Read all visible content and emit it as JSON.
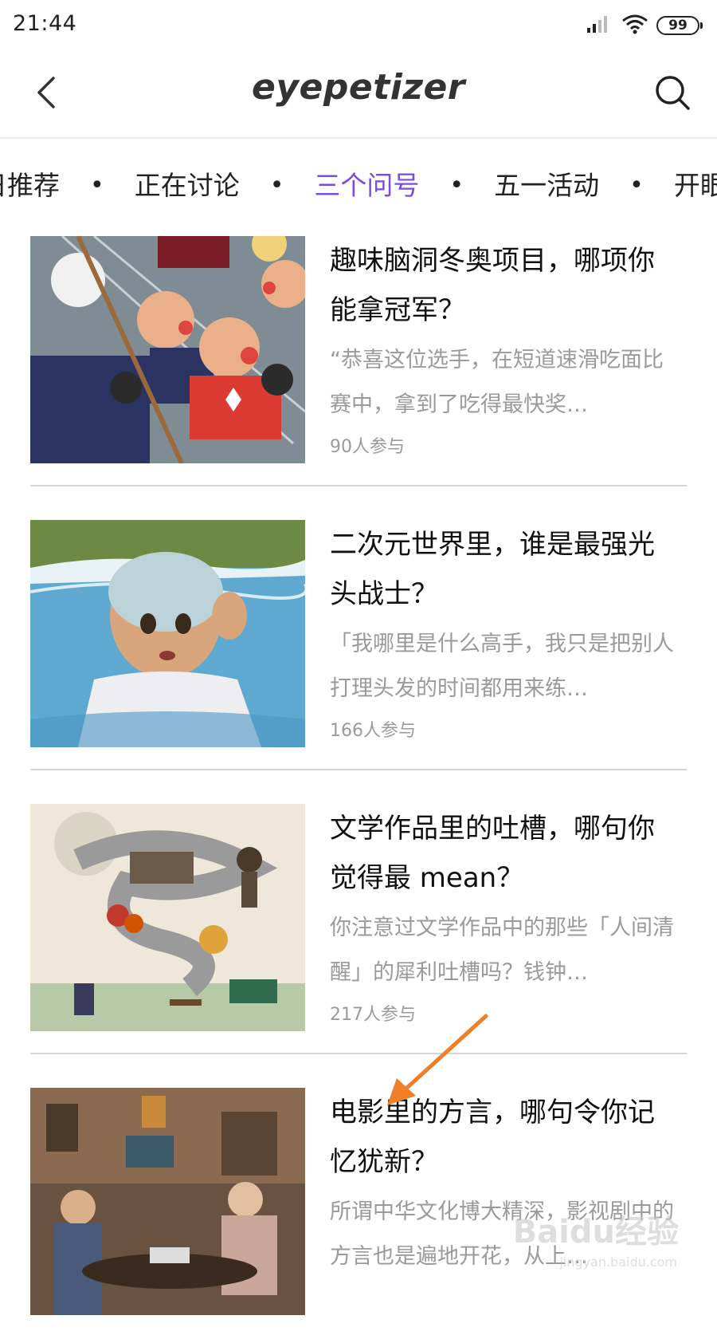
{
  "status_bar": {
    "time": "21:44",
    "battery": "99",
    "signal_icon": "signal-icon",
    "wifi_icon": "wifi-icon"
  },
  "header": {
    "logo": "eyepetizer",
    "back_icon": "back-chevron-icon",
    "search_icon": "search-icon"
  },
  "tabs": [
    {
      "label": "日推荐",
      "active": false
    },
    {
      "label": "正在讨论",
      "active": false
    },
    {
      "label": "三个问号",
      "active": true
    },
    {
      "label": "五一活动",
      "active": false
    },
    {
      "label": "开眼",
      "active": false
    }
  ],
  "tab_separator": "•",
  "accent_color": "#7a4be0",
  "items": [
    {
      "title": "趣味脑洞冬奥项目，哪项你能拿冠军？",
      "desc": "“恭喜这位选手，在短道速滑吃面比赛中，拿到了吃得最快奖…",
      "count": "90人参与"
    },
    {
      "title": "二次元世界里，谁是最强光头战士？",
      "desc": "「我哪里是什么高手，我只是把别人打理头发的时间都用来练…",
      "count": "166人参与"
    },
    {
      "title": "文学作品里的吐槽，哪句你觉得最 mean？",
      "desc": "你注意过文学作品中的那些「人间清醒」的犀利吐槽吗？钱钟…",
      "count": "217人参与"
    },
    {
      "title": "电影里的方言，哪句令你记忆犹新？",
      "desc": "所谓中华文化博大精深，影视剧中的方言也是遍地开花，从上…",
      "count": ""
    }
  ],
  "watermark": {
    "text": "Baidu经验",
    "sub": "jingyan.baidu.com"
  }
}
